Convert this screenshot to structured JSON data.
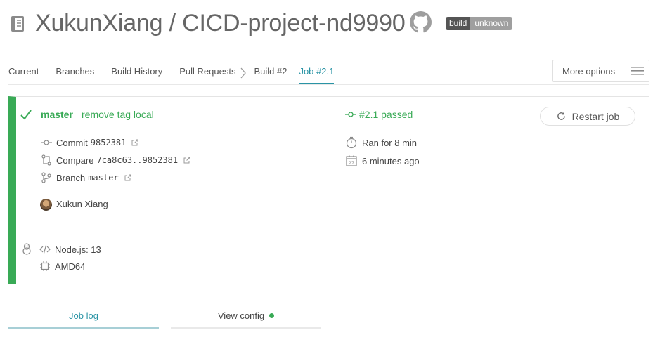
{
  "header": {
    "title": "XukunXiang / CICD-project-nd9990",
    "badge_left": "build",
    "badge_right": "unknown"
  },
  "tabs": [
    {
      "label": "Current"
    },
    {
      "label": "Branches"
    },
    {
      "label": "Build History"
    },
    {
      "label": "Pull Requests"
    },
    {
      "label": "Build #2"
    },
    {
      "label": "Job #2.1"
    }
  ],
  "more_options_label": "More options",
  "job": {
    "branch": "master",
    "message": "remove tag local",
    "status": "#2.1 passed",
    "restart_label": "Restart job",
    "commit_label": "Commit",
    "commit_sha": "9852381",
    "compare_label": "Compare",
    "compare_range": "7ca8c63..9852381",
    "branch_label": "Branch",
    "branch_value": "master",
    "author": "Xukun Xiang",
    "duration": "Ran for 8 min",
    "finished": "6 minutes ago",
    "language": "Node.js: 13",
    "arch": "AMD64"
  },
  "bottom_tabs": {
    "job_log": "Job log",
    "view_config": "View config"
  },
  "colors": {
    "passed": "#39aa56",
    "accent": "#2a94a5"
  }
}
